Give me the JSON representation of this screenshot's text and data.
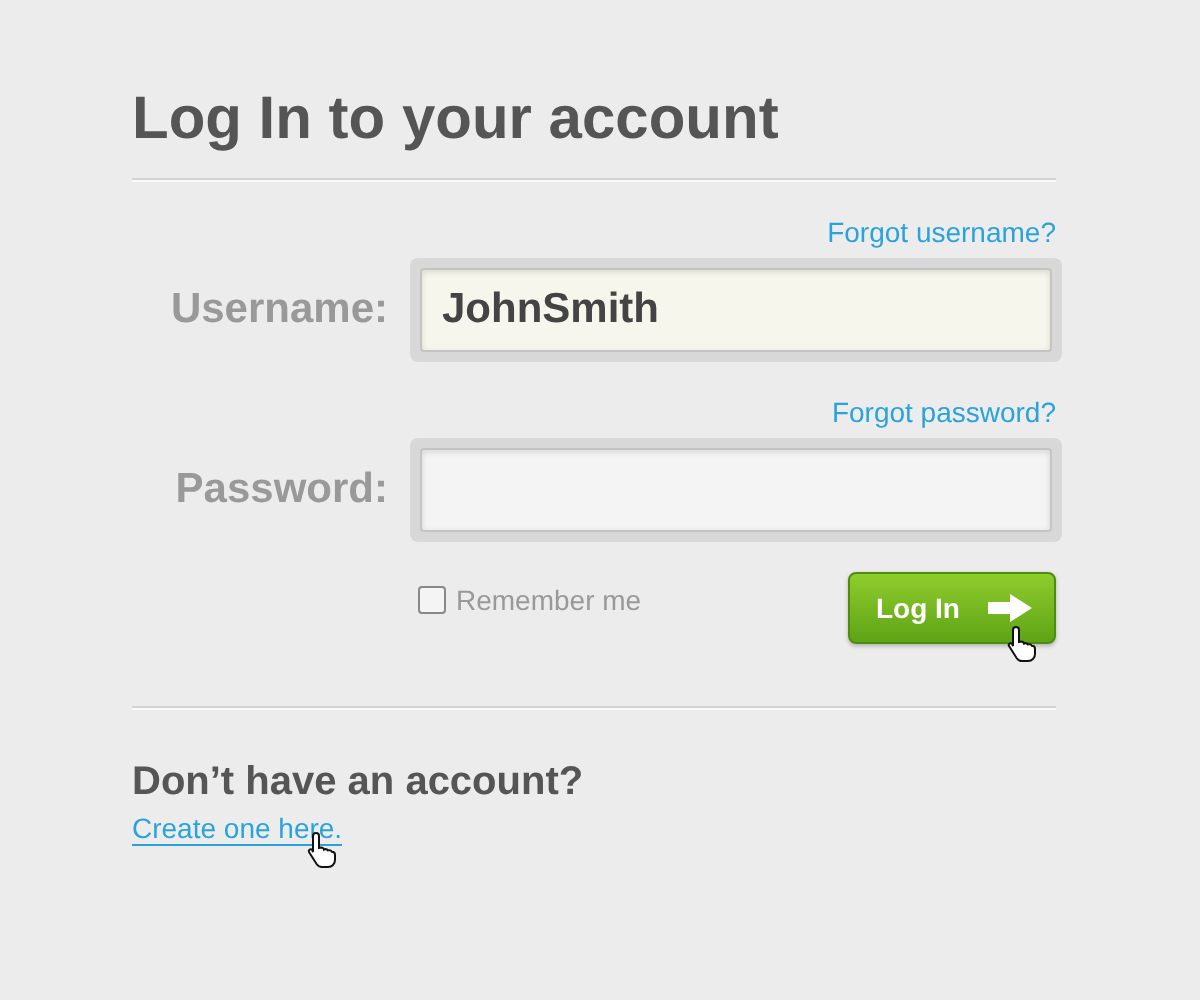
{
  "title": "Log In to your account",
  "fields": [
    {
      "kind": "text",
      "label": "Username:",
      "value": "JohnSmith",
      "link": "Forgot username?"
    },
    {
      "kind": "password",
      "label": "Password:",
      "link": "Forgot password?"
    }
  ],
  "remember": {
    "label": "Remember me",
    "checked": false
  },
  "login_button": {
    "label": "Log In"
  },
  "signup": {
    "heading": "Don’t have an account?",
    "link": "Create one here."
  }
}
